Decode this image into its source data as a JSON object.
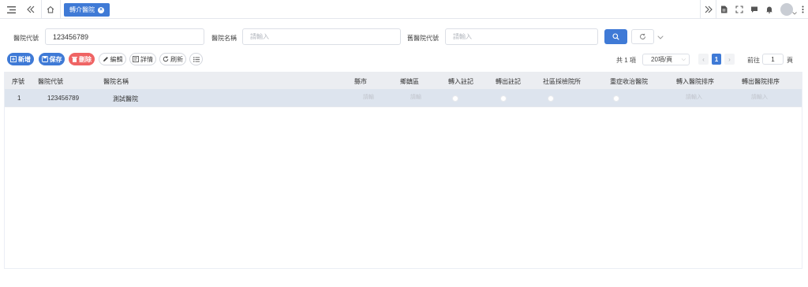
{
  "topbar": {
    "menu_icon": "hamburger-icon",
    "collapse_icon": "double-chevron-left-icon",
    "home_icon": "home-icon",
    "active_tab": "轉介醫院",
    "right_icons": [
      "double-chevron-right-icon",
      "document-icon",
      "fullscreen-icon",
      "chat-icon",
      "bell-icon",
      "avatar",
      "more-vertical-icon"
    ]
  },
  "search": {
    "hospital_code_label": "醫院代號",
    "hospital_code_value": "123456789",
    "hospital_name_label": "醫院名稱",
    "hospital_name_placeholder": "請輸入",
    "old_code_label": "舊醫院代號",
    "old_code_placeholder": "請輸入"
  },
  "toolbar": {
    "add": "新增",
    "save": "保存",
    "delete": "刪除",
    "edit": "編輯",
    "details": "詳情",
    "refresh": "刷新",
    "columns_icon": "list-settings-icon"
  },
  "pager": {
    "total": "共 1 項",
    "page_size": "20項/頁",
    "current": "1",
    "goto_label": "前往",
    "goto_value": "1",
    "page_suffix": "頁"
  },
  "table": {
    "headers": [
      "序號",
      "醫院代號",
      "醫院名稱",
      "縣市",
      "鄉鎮區",
      "轉入註記",
      "轉出註記",
      "社區採檢院所",
      "重症收治醫院",
      "轉入醫院排序",
      "轉出醫院排序"
    ],
    "rows": [
      {
        "index": "1",
        "code": "123456789",
        "name": "測試醫院",
        "city_placeholder": "請輸",
        "district_placeholder": "請輸",
        "in_sort_placeholder": "請輸入",
        "out_sort_placeholder": "請輸入"
      }
    ]
  },
  "colors": {
    "primary": "#3f7ad6",
    "danger": "#ef6464",
    "header_bg": "#ebedf1",
    "row_bg": "#dde4ee"
  }
}
